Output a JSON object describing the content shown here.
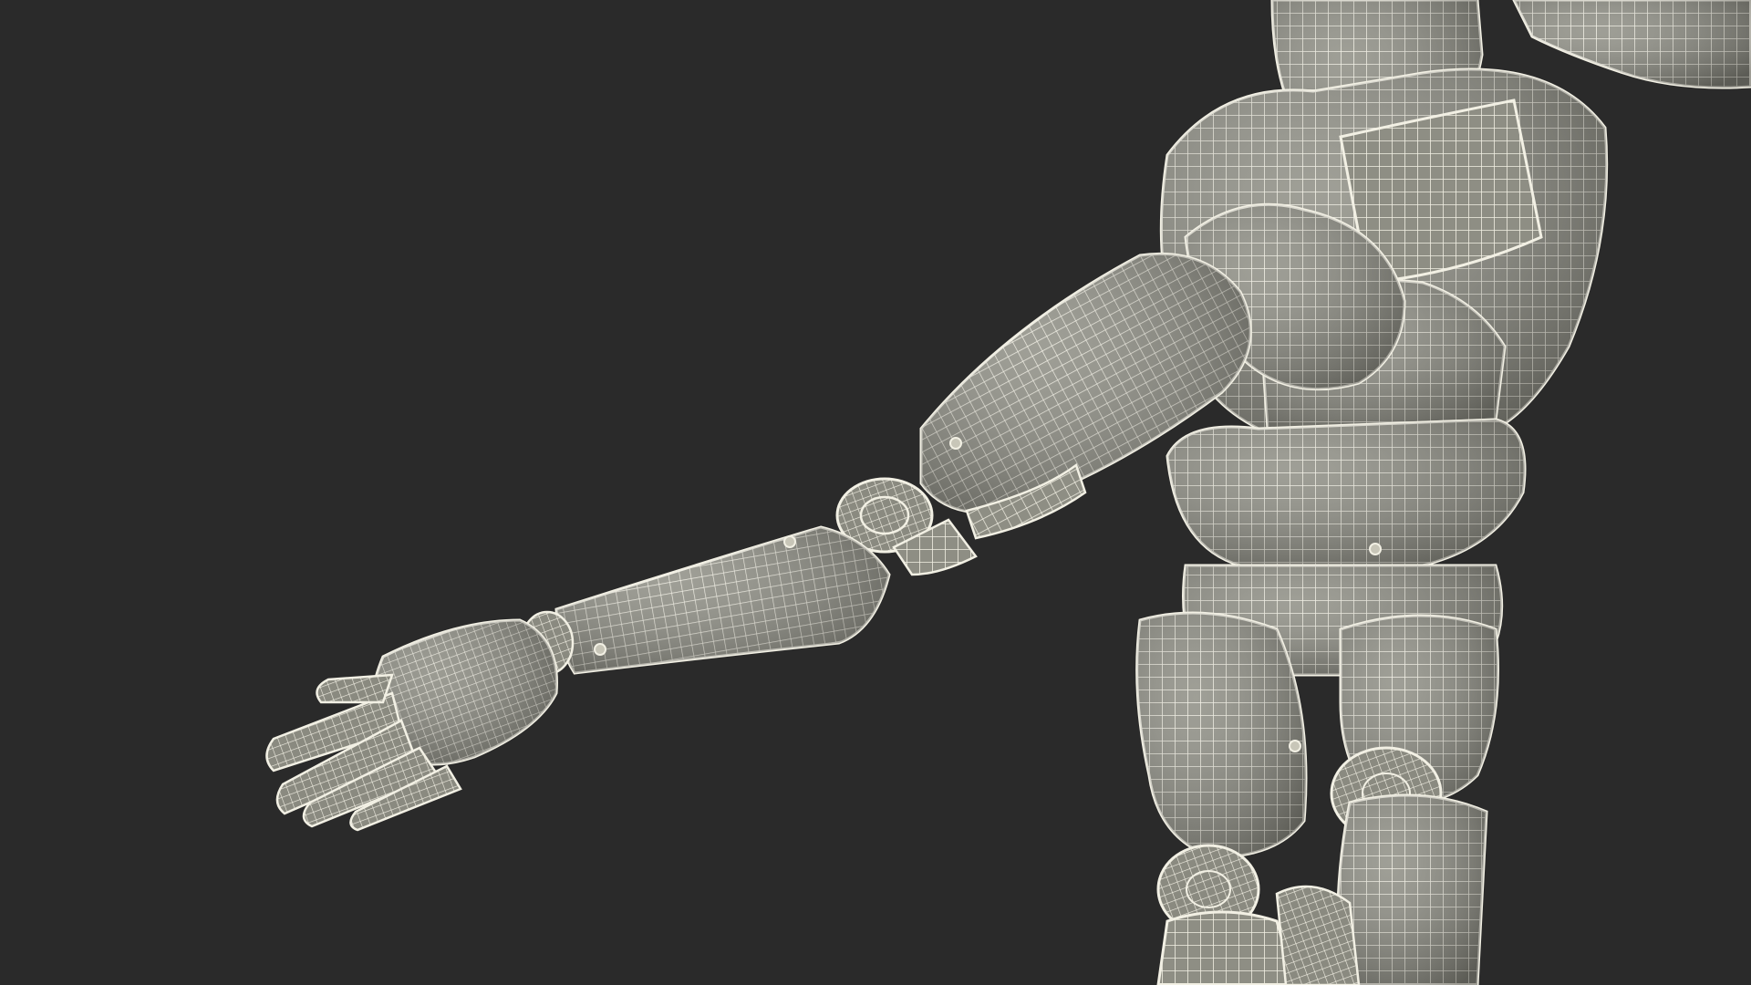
{
  "scene": {
    "background_color": "#2a2a2a",
    "model_fill_color": "#8e8e84",
    "model_highlight_color": "#b9b9ad",
    "wire_color": "#f2f0e4",
    "shadow_color": "#5c5c55",
    "subject": "robot-wireframe-model"
  }
}
